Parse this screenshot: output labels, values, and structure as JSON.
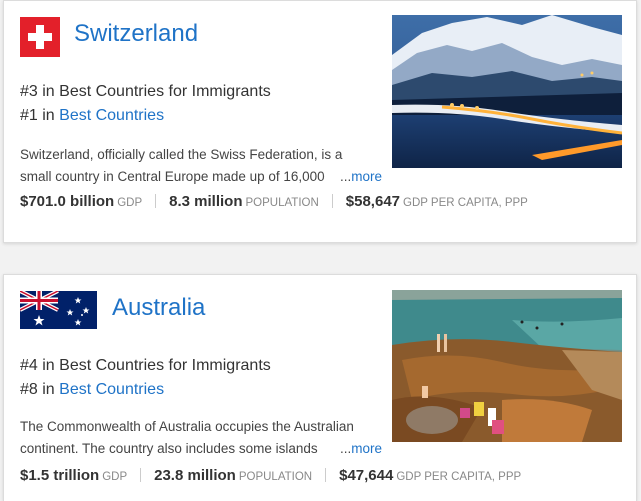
{
  "countries": [
    {
      "name": "Switzerland",
      "flag_icon": "swiss-flag-icon",
      "rank_primary_text": "#3 in Best Countries for Immigrants",
      "rank_secondary_prefix": "#1 in ",
      "rank_secondary_link": "Best Countries",
      "description_line1": "Switzerland, officially called the Swiss Federation, is a",
      "description_line2": "small country in Central Europe made up of 16,000",
      "more_dots": "...",
      "more_label": "more",
      "gdp_value": "$701.0 billion",
      "gdp_label": "GDP",
      "population_value": "8.3 million",
      "population_label": "POPULATION",
      "per_capita_value": "$58,647",
      "per_capita_label": "GDP PER CAPITA, PPP"
    },
    {
      "name": "Australia",
      "flag_icon": "australian-flag-icon",
      "rank_primary_text": "#4 in Best Countries for Immigrants",
      "rank_secondary_prefix": "#8 in ",
      "rank_secondary_link": "Best Countries",
      "description_line1": "The Commonwealth of Australia occupies the Australian",
      "description_line2": "continent. The country also includes some islands",
      "more_dots": "...",
      "more_label": "more",
      "gdp_value": "$1.5 trillion",
      "gdp_label": "GDP",
      "population_value": "23.8 million",
      "population_label": "POPULATION",
      "per_capita_value": "$47,644",
      "per_capita_label": "GDP PER CAPITA, PPP"
    }
  ],
  "colors": {
    "link_blue": "#1f73c7",
    "swiss_red": "#e3202a",
    "aus_blue": "#012169",
    "background": "#f2f2f2"
  }
}
